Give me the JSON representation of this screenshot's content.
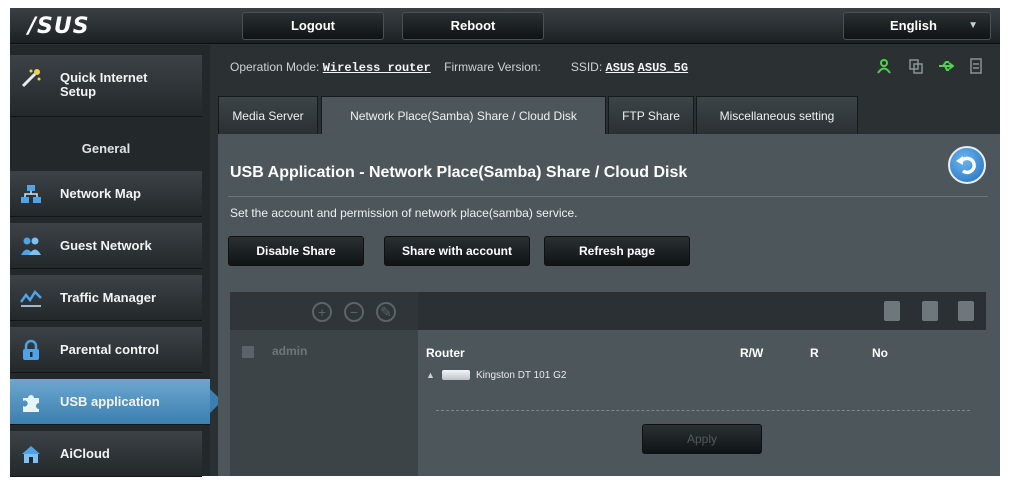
{
  "brand": "/SUS",
  "topbar": {
    "logout_label": "Logout",
    "reboot_label": "Reboot",
    "language": "English"
  },
  "sidebar": {
    "quick_setup": "Quick Internet Setup",
    "section_title": "General",
    "items": [
      {
        "label": "Network Map",
        "icon": "network-map-icon"
      },
      {
        "label": "Guest Network",
        "icon": "guest-network-icon"
      },
      {
        "label": "Traffic Manager",
        "icon": "traffic-manager-icon"
      },
      {
        "label": "Parental control",
        "icon": "lock-icon"
      },
      {
        "label": "USB application",
        "icon": "puzzle-icon"
      },
      {
        "label": "AiCloud",
        "icon": "cloud-house-icon"
      }
    ],
    "active": "USB application"
  },
  "status": {
    "op_mode_label": "Operation Mode:",
    "op_mode_value": "Wireless router",
    "firmware_label": "Firmware Version:",
    "ssid_label": "SSID:",
    "ssid_1": "ASUS",
    "ssid_2": "ASUS_5G",
    "icons": [
      "user-icon",
      "copy-icon",
      "usb-icon",
      "printer-icon"
    ]
  },
  "tabs": [
    {
      "label": "Media Server"
    },
    {
      "label": "Network Place(Samba) Share / Cloud Disk"
    },
    {
      "label": "FTP Share"
    },
    {
      "label": "Miscellaneous setting"
    }
  ],
  "active_tab": "Network Place(Samba) Share / Cloud Disk",
  "main": {
    "title": "USB Application - Network Place(Samba) Share / Cloud Disk",
    "description": "Set the account and permission of network place(samba) service.",
    "buttons": {
      "disable": "Disable Share",
      "share_account": "Share with account",
      "refresh": "Refresh page"
    },
    "user": "admin",
    "table": {
      "col_router": "Router",
      "col_rw": "R/W",
      "col_r": "R",
      "col_no": "No",
      "device": "Kingston DT 101 G2"
    },
    "apply": "Apply"
  },
  "colors": {
    "accent": "#3b7fb0",
    "panel": "#4d565b",
    "sidebar": "#23282b",
    "status_green": "#4fd34a"
  }
}
